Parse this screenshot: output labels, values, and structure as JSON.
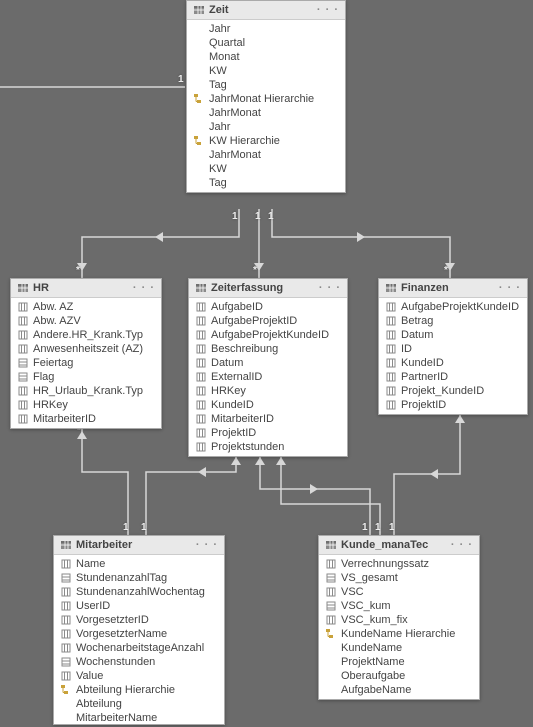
{
  "tables": {
    "zeit": {
      "title": "Zeit",
      "fields": [
        "Jahr",
        "Quartal",
        "Monat",
        "KW",
        "Tag"
      ],
      "hierarchies": [
        {
          "name": "JahrMonat Hierarchie",
          "levels": [
            "JahrMonat",
            "Jahr"
          ]
        },
        {
          "name": "KW Hierarchie",
          "levels": [
            "JahrMonat",
            "KW",
            "Tag"
          ]
        }
      ]
    },
    "hr": {
      "title": "HR",
      "fields": [
        "Abw. AZ",
        "Abw. AZV",
        "Andere.HR_Krank.Typ",
        "Anwesenheitszeit (AZ)",
        "Feiertag",
        "Flag",
        "HR_Urlaub_Krank.Typ",
        "HRKey",
        "MitarbeiterID"
      ]
    },
    "zeiterfassung": {
      "title": "Zeiterfassung",
      "fields": [
        "AufgabeID",
        "AufgabeProjektID",
        "AufgabeProjektKundeID",
        "Beschreibung",
        "Datum",
        "ExternalID",
        "HRKey",
        "KundeID",
        "MitarbeiterID",
        "ProjektID",
        "Projektstunden"
      ]
    },
    "finanzen": {
      "title": "Finanzen",
      "fields": [
        "AufgabeProjektKundeID",
        "Betrag",
        "Datum",
        "ID",
        "KundeID",
        "PartnerID",
        "Projekt_KundeID",
        "ProjektID"
      ]
    },
    "mitarbeiter": {
      "title": "Mitarbeiter",
      "fields": [
        "Name",
        "StundenanzahlTag",
        "StundenanzahlWochentag",
        "UserID",
        "VorgesetzterID",
        "VorgesetzterName",
        "WochenarbeitstageAnzahl",
        "Wochenstunden",
        "Value"
      ],
      "hierarchies": [
        {
          "name": "Abteilung Hierarchie",
          "levels": [
            "Abteilung",
            "MitarbeiterName"
          ]
        }
      ]
    },
    "kunde": {
      "title": "Kunde_manaTec",
      "fields": [
        "Verrechnungssatz",
        "VS_gesamt",
        "VSC",
        "VSC_kum",
        "VSC_kum_fix"
      ],
      "hierarchies": [
        {
          "name": "KundeName Hierarchie",
          "levels": [
            "KundeName",
            "ProjektName",
            "Oberaufgabe",
            "AufgabeName"
          ]
        }
      ]
    }
  },
  "cardinality_glyphs": {
    "one": "1",
    "many": "*"
  },
  "menu_glyph": "· · ·"
}
